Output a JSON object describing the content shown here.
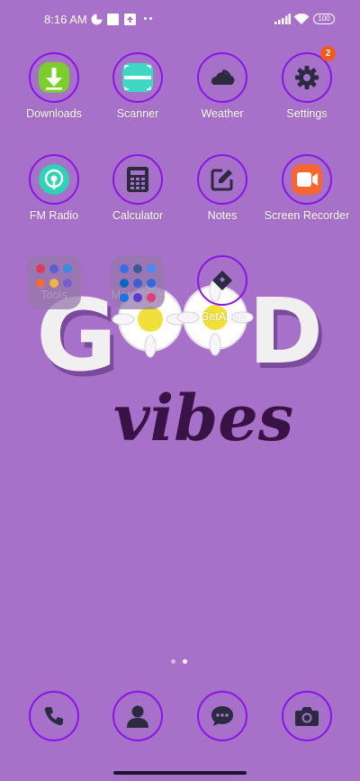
{
  "status_bar": {
    "time": "8:16 AM",
    "battery": "100"
  },
  "apps_row1": [
    {
      "label": "Downloads",
      "icon": "download-icon"
    },
    {
      "label": "Scanner",
      "icon": "scanner-icon"
    },
    {
      "label": "Weather",
      "icon": "weather-icon"
    },
    {
      "label": "Settings",
      "icon": "gear-icon",
      "badge": "2"
    }
  ],
  "apps_row2": [
    {
      "label": "FM Radio",
      "icon": "radio-icon"
    },
    {
      "label": "Calculator",
      "icon": "calculator-icon"
    },
    {
      "label": "Notes",
      "icon": "notes-icon"
    },
    {
      "label": "Screen Recorder",
      "icon": "recorder-icon"
    }
  ],
  "apps_row3": [
    {
      "label": "Tools",
      "icon": "folder-icon"
    },
    {
      "label": "More apps",
      "icon": "folder-icon"
    },
    {
      "label": "GetApps",
      "icon": "getapps-icon"
    }
  ],
  "wallpaper": {
    "word1": "GOOD",
    "word2": "vibes"
  },
  "dock": [
    {
      "icon": "phone-icon"
    },
    {
      "icon": "contacts-icon"
    },
    {
      "icon": "messages-icon"
    },
    {
      "icon": "camera-icon"
    }
  ],
  "colors": {
    "background": "#a770c9",
    "ring": "#8a14e6",
    "badge": "#f25c1b"
  }
}
